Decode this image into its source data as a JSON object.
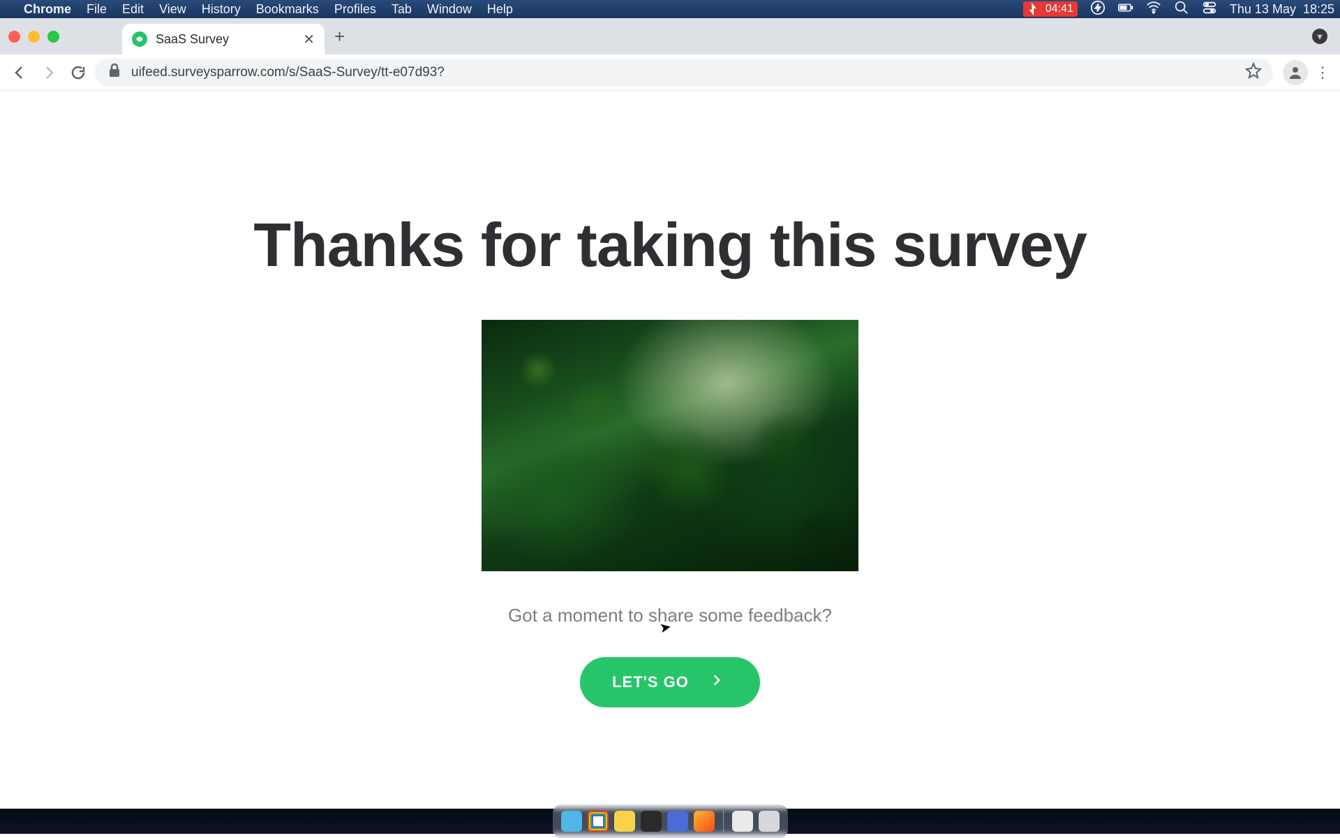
{
  "menubar": {
    "app": "Chrome",
    "items": [
      "File",
      "Edit",
      "View",
      "History",
      "Bookmarks",
      "Profiles",
      "Tab",
      "Window",
      "Help"
    ],
    "battery_time": "04:41",
    "date": "Thu 13 May",
    "time": "18:25"
  },
  "browser": {
    "tab_title": "SaaS Survey",
    "url": "uifeed.surveysparrow.com/s/SaaS-Survey/tt-e07d93?"
  },
  "survey": {
    "heading": "Thanks for taking this survey",
    "subtext": "Got a moment to share some feedback?",
    "cta": "LET'S GO",
    "image_alt": "forest-hero-image"
  },
  "colors": {
    "cta_bg": "#27c56a"
  }
}
